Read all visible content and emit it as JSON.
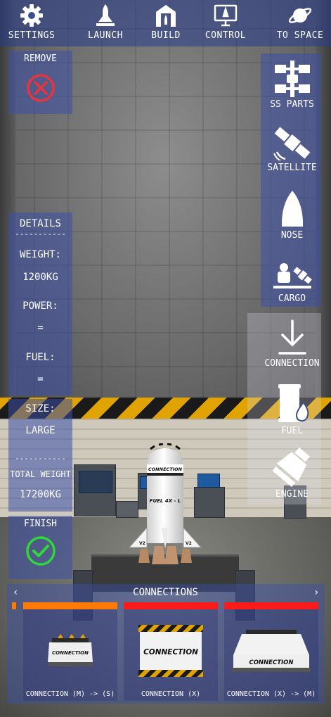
{
  "topbar": {
    "items": [
      {
        "label": "SETTINGS",
        "icon": "gear-icon"
      },
      {
        "label": "LAUNCH",
        "icon": "launch-icon"
      },
      {
        "label": "BUILD",
        "icon": "hangar-icon"
      },
      {
        "label": "CONTROL",
        "icon": "monitor-icon"
      },
      {
        "label": "TO SPACE",
        "icon": "planet-icon"
      }
    ]
  },
  "remove": {
    "label": "REMOVE",
    "icon": "remove-x-icon",
    "color": "#e8343c"
  },
  "details": {
    "title": "DETAILS",
    "divider": "-----------",
    "weight_label": "WEIGHT:",
    "weight_value": "1200KG",
    "power_label": "POWER:",
    "power_value": "=",
    "fuel_label": "FUEL:",
    "fuel_value": "=",
    "size_label": "SIZE:",
    "size_value": "LARGE",
    "divider2": "-----------",
    "total_weight_label": "TOTAL WEIGHT",
    "total_weight_value": "17200KG"
  },
  "finish": {
    "label": "FINISH",
    "icon": "checkmark-icon",
    "color": "#2fd83a"
  },
  "side_menu": {
    "items": [
      {
        "label": "SS PARTS",
        "icon": "space-station-icon"
      },
      {
        "label": "SATELLITE",
        "icon": "satellite-icon"
      },
      {
        "label": "NOSE",
        "icon": "nose-cone-icon"
      },
      {
        "label": "CARGO",
        "icon": "cargo-icon"
      },
      {
        "label": "CONNECTION",
        "icon": "download-arrow-icon"
      },
      {
        "label": "FUEL",
        "icon": "fuel-tank-icon"
      },
      {
        "label": "ENGINE",
        "icon": "engine-icon"
      }
    ]
  },
  "rocket": {
    "label_top": "CONNECTION",
    "label_body": "FUEL 4X - L",
    "badge_left": "V2",
    "badge_right": "V2"
  },
  "connections": {
    "title": "CONNECTIONS",
    "prev": "‹",
    "next": "›",
    "parts": [
      {
        "name": "CONNECTION (M) -> (S)",
        "pic_text": "CONNECTION",
        "bar_color": "#ff7a00"
      },
      {
        "name": "CONNECTION (X)",
        "pic_text": "CONNECTION",
        "bar_color": "#ff1a1a"
      },
      {
        "name": "CONNECTION (X) -> (M)",
        "pic_text": "CONNECTION",
        "bar_color": "#ff1a1a"
      }
    ],
    "edge_bar_color": "#ff7a00"
  }
}
